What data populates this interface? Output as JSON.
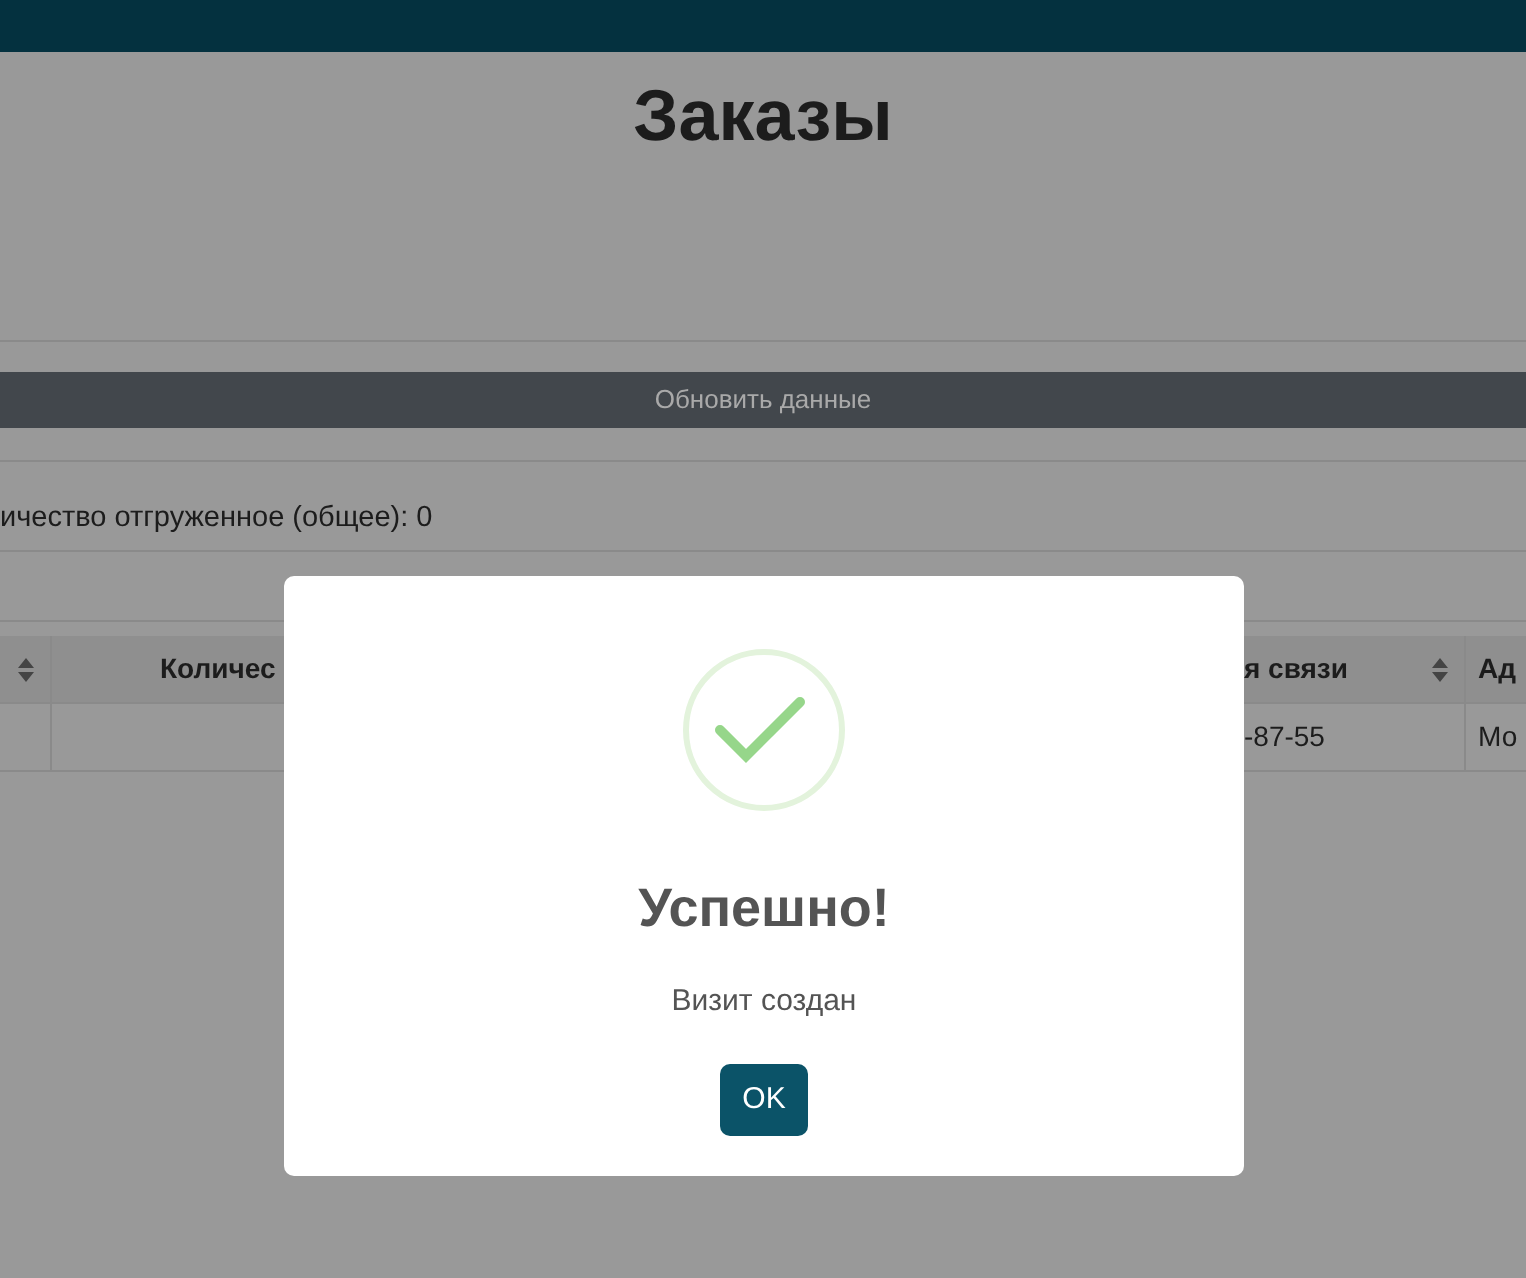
{
  "page": {
    "title": "Заказы",
    "refresh_button": "Обновить данные",
    "summary": "ичество отгруженное (общее): 0"
  },
  "table": {
    "columns": [
      {
        "sortable": true
      },
      {
        "label": "Количес"
      },
      {
        "label": "я связи",
        "sortable": true
      },
      {
        "label": "Ад"
      }
    ],
    "rows": [
      [
        "",
        "",
        "-87-55",
        "Мо"
      ]
    ]
  },
  "modal": {
    "title": "Успешно!",
    "message": "Визит создан",
    "button": "OK"
  }
}
